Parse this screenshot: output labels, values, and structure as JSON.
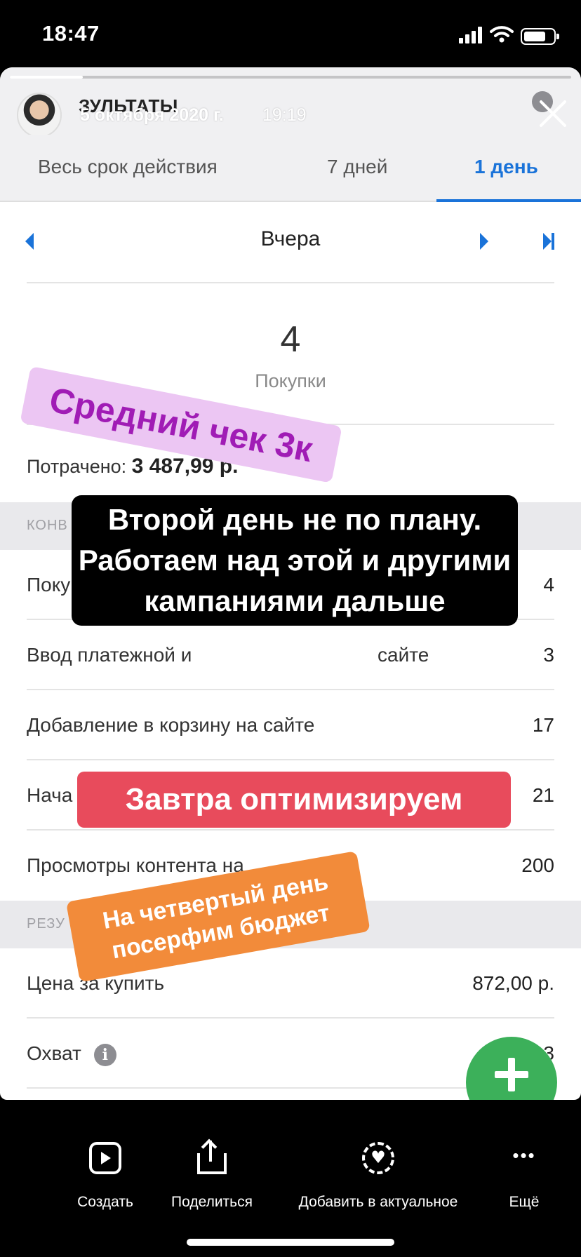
{
  "status_bar": {
    "time": "18:47"
  },
  "story": {
    "header_title": "ЗУЛЬТАТЫ",
    "date": "5 октября 2020 г.",
    "time": "19:19",
    "progress": 0.13
  },
  "tabs": [
    {
      "label": "Весь срок действия",
      "active": false
    },
    {
      "label": "7 дней",
      "active": false
    },
    {
      "label": "1 день",
      "active": true
    }
  ],
  "day_nav": {
    "label": "Вчера"
  },
  "summary": {
    "value": "4",
    "label": "Покупки",
    "spent_label": "Потрачено:",
    "spent_value": "3 487,99 р."
  },
  "sections": {
    "conversions": "КОНВ",
    "results": "РЕЗУ"
  },
  "rows": [
    {
      "name": "Покупк",
      "value": "4"
    },
    {
      "name": "Ввод платежной и",
      "name_tail": "сайте",
      "value": "3"
    },
    {
      "name": "Добавление в корзину на сайте",
      "value": "17"
    },
    {
      "name": "Нача",
      "value": "21"
    },
    {
      "name": "Просмотры контента на",
      "value": "200"
    },
    {
      "name": "Цена за купить",
      "value": "872,00 р."
    },
    {
      "name": "Охват",
      "value": "3"
    }
  ],
  "stickers": {
    "pink": "Средний чек 3к",
    "black": "Второй день не по плану. Работаем над этой и другими кампаниями дальше",
    "red": "Завтра оптимизируем",
    "orange": "На четвертый день посерфим бюджет"
  },
  "bottom_bar": [
    {
      "label": "Создать",
      "icon": "reels-create-icon"
    },
    {
      "label": "Поделиться",
      "icon": "share-icon"
    },
    {
      "label": "Добавить в актуальное",
      "icon": "highlight-heart-icon"
    },
    {
      "label": "Ещё",
      "icon": "more-icon"
    }
  ],
  "colors": {
    "accent_blue": "#1a73d9",
    "fab_green": "#3cb05a",
    "sticker_pink_bg": "#ecc6f3",
    "sticker_pink_text": "#a01cb5",
    "sticker_red": "#e84b5c",
    "sticker_orange": "#f28b3a"
  }
}
